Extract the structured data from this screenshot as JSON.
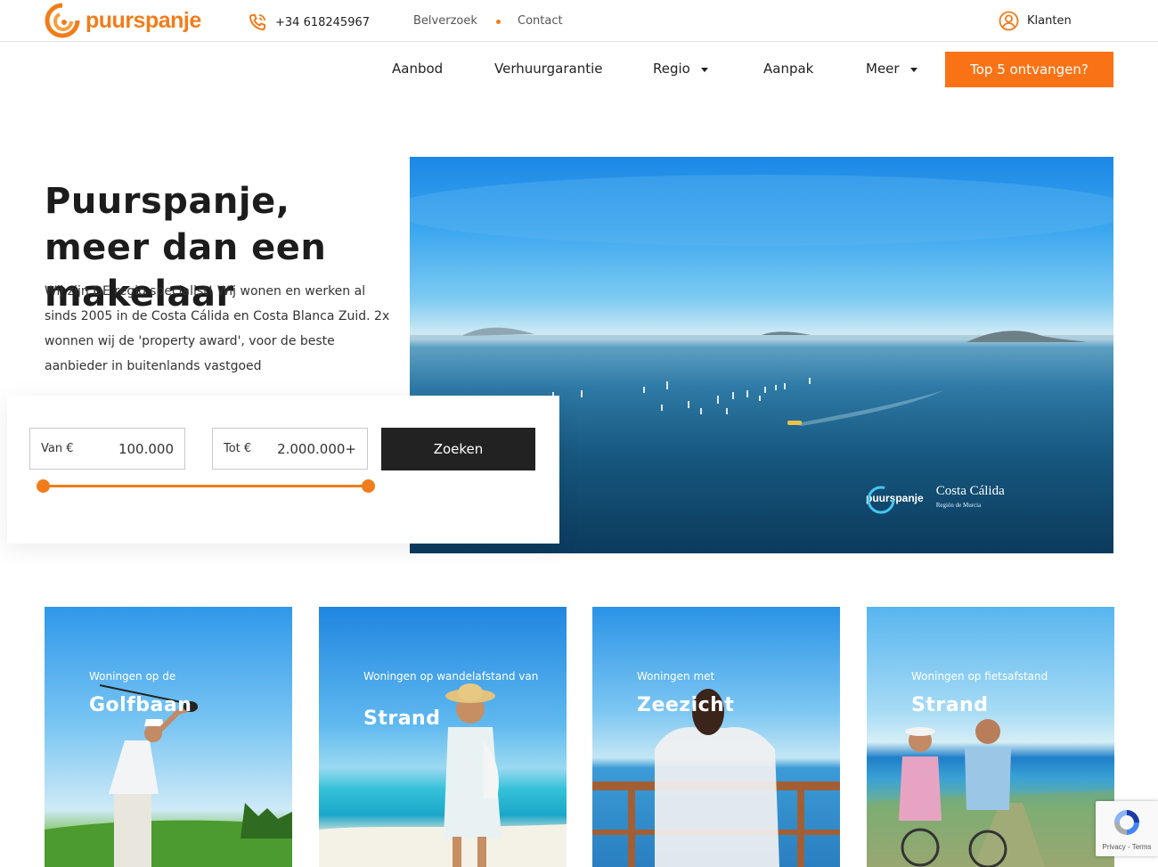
{
  "brand": {
    "name": "puurspanje",
    "accent": "#f07d1a",
    "cta_color": "#f97316"
  },
  "topbar": {
    "phone_icon": "phone-icon",
    "phone": "+34 618245967",
    "callback_label": "Belverzoek",
    "contact_label": "Contact",
    "account_icon": "user-circle-icon",
    "account_label": "Klanten"
  },
  "nav": {
    "items": [
      {
        "label": "Aanbod",
        "dropdown": false
      },
      {
        "label": "Verhuurgarantie",
        "dropdown": false
      },
      {
        "label": "Regio",
        "dropdown": true
      },
      {
        "label": "Aanpak",
        "dropdown": false
      },
      {
        "label": "Meer",
        "dropdown": true
      }
    ],
    "cta_label": "Top 5 ontvangen?"
  },
  "hero": {
    "title": "Puurspanje, meer dan een makelaar",
    "text": "Wij zijn DE regio specialist! Wij wonen en werken al sinds 2005 in de Costa Cálida en Costa Blanca Zuid. 2x wonnen wij de 'property award', voor de beste aanbieder in buitenlands vastgoed",
    "image_watermark": {
      "brand": "puurspanje",
      "region": "Costa Cálida",
      "region_sub": "Región de Murcia"
    }
  },
  "search": {
    "min_label": "Van €",
    "min_value": "100.000",
    "max_label": "Tot €",
    "max_value": "2.000.000+",
    "button_label": "Zoeken",
    "slider_min_fraction": 0,
    "slider_max_fraction": 1
  },
  "cards": [
    {
      "pre": "Woningen op de",
      "title": "Golfbaan"
    },
    {
      "pre": "Woningen op wandelafstand van",
      "title": "Strand"
    },
    {
      "pre": "Woningen met",
      "title": "Zeezicht"
    },
    {
      "pre": "Woningen op fietsafstand",
      "title": "Strand"
    }
  ],
  "recaptcha": {
    "label": "Privacy - Terms"
  }
}
